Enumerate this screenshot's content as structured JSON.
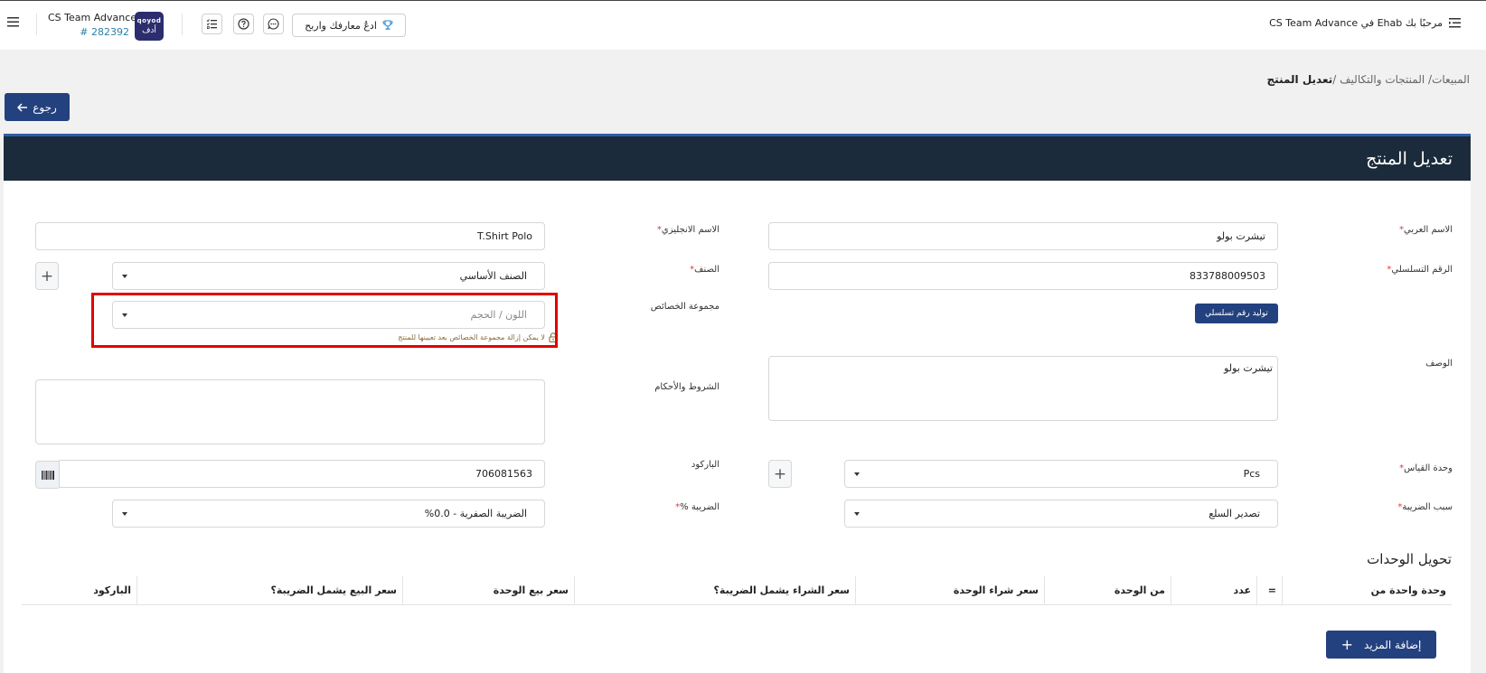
{
  "topbar": {
    "welcome": "مرحبًا بك Ehab في CS Team Advance",
    "company_name": "CS Team Advance",
    "company_number": "# 282392",
    "logo_line1": "qoyod",
    "logo_line2": "أدف",
    "promo_label": "ادعُ معارفك واربح"
  },
  "breadcrumb": {
    "sales": "المبيعات",
    "products": "المنتجات والتكاليف",
    "sep": "/",
    "current": "تعديل المنتج"
  },
  "back_button": "رجوع",
  "card_title": "تعديل المنتج",
  "form": {
    "arabic_name_label": "الاسم العربي",
    "arabic_name_value": "تيشرت بولو",
    "english_name_label": "الاسم الانجليزي",
    "english_name_value": "T.Shirt Polo",
    "serial_label": "الرقم التسلسلي",
    "serial_value": "833788009503",
    "category_label": "الصنف",
    "category_value": "الصنف الأساسي",
    "generate_serial_button": "توليد رقم تسلسلي",
    "attr_group_label": "مجموعة الخصائص",
    "attr_group_value": "اللون / الحجم",
    "attr_group_hint": "لا يمكن إزالة مجموعة الخصائص بعد تعيينها للمنتج",
    "description_label": "الوصف",
    "description_value": "تيشرت بولو",
    "terms_label": "الشروط والأحكام",
    "terms_value": "",
    "unit_label": "وحدة القياس",
    "unit_value": "Pcs",
    "barcode_label": "الباركود",
    "barcode_value": "706081563",
    "tax_reason_label": "سبب الضريبة",
    "tax_reason_value": "تصدير السلع",
    "tax_label": "الضريبة %",
    "tax_value": "الضريبة الصفرية - 0.0%",
    "required_mark": "*",
    "plus": "+"
  },
  "units": {
    "title": "تحويل الوحدات",
    "columns": [
      "وحدة واحدة من",
      "=",
      "عدد",
      "من الوحدة",
      "سعر شراء الوحدة",
      "سعر الشراء يشمل الضريبة؟",
      "سعر بيع الوحدة",
      "سعر البيع يشمل الضريبة؟",
      "الباركود"
    ],
    "add_more": "إضافة المزيد"
  },
  "colors": {
    "primary": "#23417f",
    "header_dark": "#1b2b3b",
    "highlight": "#e10000",
    "required": "#e23b3b"
  },
  "icons": [
    "menu-icon",
    "hamburger-icon",
    "trophy-icon",
    "chat-icon",
    "help-icon",
    "checklist-icon",
    "arrow-left-icon",
    "plus-icon",
    "lock-icon",
    "barcode-icon",
    "caret-down-icon"
  ]
}
